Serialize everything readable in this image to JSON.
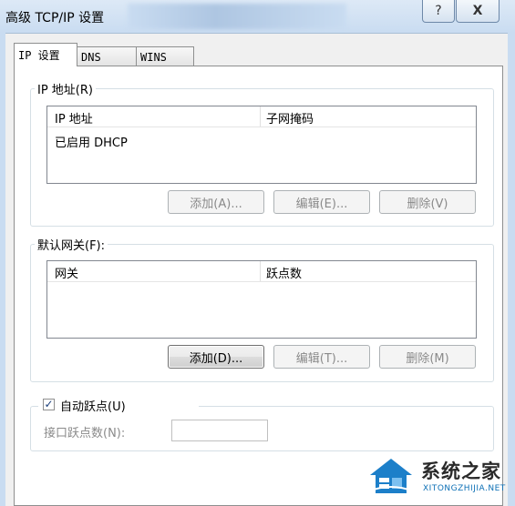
{
  "window": {
    "title": "高级 TCP/IP 设置",
    "help_glyph": "?",
    "close_glyph": "X"
  },
  "tabs": [
    {
      "label": "IP 设置",
      "active": true
    },
    {
      "label": "DNS",
      "active": false
    },
    {
      "label": "WINS",
      "active": false
    }
  ],
  "ip_section": {
    "title": "IP 地址(R)",
    "columns": [
      "IP 地址",
      "子网掩码"
    ],
    "rows": [
      [
        "已启用 DHCP",
        ""
      ]
    ],
    "buttons": {
      "add": "添加(A)...",
      "edit": "编辑(E)...",
      "delete": "删除(V)"
    }
  },
  "gateway_section": {
    "title": "默认网关(F):",
    "columns": [
      "网关",
      "跃点数"
    ],
    "rows": [],
    "buttons": {
      "add": "添加(D)...",
      "edit": "编辑(T)...",
      "delete": "删除(M)"
    }
  },
  "metric": {
    "auto_label": "自动跃点(U)",
    "auto_checked": true,
    "check_glyph": "✓",
    "interface_label": "接口跃点数(N):",
    "interface_value": ""
  },
  "watermark": {
    "text": "系统之家",
    "subtext": "XITONGZHIJIA.NET"
  }
}
